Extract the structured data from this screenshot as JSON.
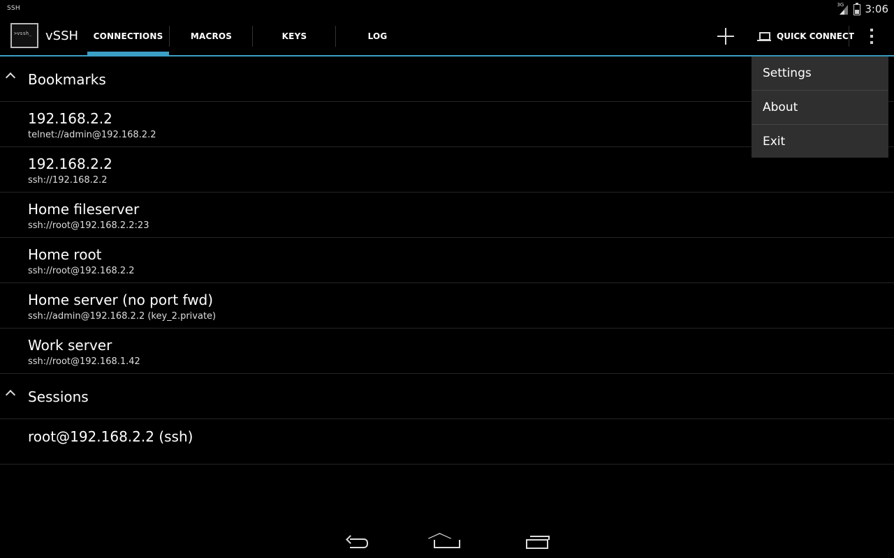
{
  "status": {
    "left_label": "SSH",
    "network_label": "3G",
    "time": "3:06"
  },
  "actionbar": {
    "logo_text": ">vssh_",
    "app_title": "vSSH",
    "tabs": [
      {
        "label": "CONNECTIONS",
        "active": true
      },
      {
        "label": "MACROS",
        "active": false
      },
      {
        "label": "KEYS",
        "active": false
      },
      {
        "label": "LOG",
        "active": false
      }
    ],
    "quick_connect_label": "QUICK CONNECT",
    "icons": {
      "add": "plus-icon",
      "quick": "laptop-icon",
      "overflow": "overflow-menu-icon"
    }
  },
  "bookmarks": {
    "header": "Bookmarks",
    "items": [
      {
        "title": "192.168.2.2",
        "subtitle": "telnet://admin@192.168.2.2"
      },
      {
        "title": "192.168.2.2",
        "subtitle": "ssh://192.168.2.2"
      },
      {
        "title": "Home fileserver",
        "subtitle": "ssh://root@192.168.2.2:23"
      },
      {
        "title": "Home root",
        "subtitle": "ssh://root@192.168.2.2"
      },
      {
        "title": "Home server (no port fwd)",
        "subtitle": "ssh://admin@192.168.2.2 (key_2.private)"
      },
      {
        "title": "Work server",
        "subtitle": "ssh://root@192.168.1.42"
      }
    ]
  },
  "sessions": {
    "header": "Sessions",
    "items": [
      {
        "title": "root@192.168.2.2 (ssh)"
      }
    ]
  },
  "overflow_menu": {
    "items": [
      {
        "label": "Settings"
      },
      {
        "label": "About"
      },
      {
        "label": "Exit"
      }
    ]
  }
}
